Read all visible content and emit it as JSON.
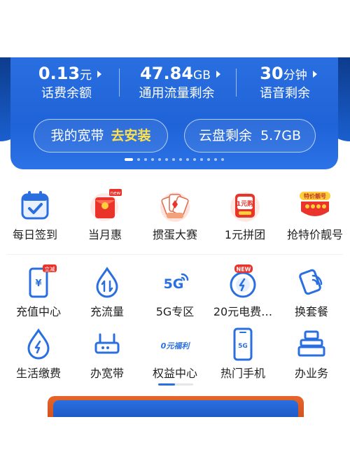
{
  "account": {
    "balance": {
      "value": "0.13",
      "unit": "元",
      "label": "话费余额"
    },
    "data": {
      "value": "47.84",
      "unit": "GB",
      "label": "通用流量剩余"
    },
    "voice": {
      "value": "30",
      "unit": "分钟",
      "label": "语音剩余"
    }
  },
  "pills": {
    "broadband": {
      "label": "我的宽带",
      "action": "去安装"
    },
    "cloud": {
      "label": "云盘剩余",
      "value": "5.7GB"
    }
  },
  "colors": {
    "primary": "#2a6fe0",
    "highlight": "#ffe14a",
    "promo": "#e7652a"
  },
  "promo_row": [
    {
      "label": "每日签到",
      "icon": "calendar-check-icon"
    },
    {
      "label": "当月惠",
      "icon": "red-envelope-icon",
      "badge": "new"
    },
    {
      "label": "掼蛋大赛",
      "icon": "playing-cards-icon"
    },
    {
      "label": "1元拼团",
      "icon": "one-yuan-group-icon",
      "icon_text": "1元购"
    },
    {
      "label": "抢特价靓号",
      "icon": "special-number-icon",
      "icon_text": "特价靓号"
    }
  ],
  "service_row1": [
    {
      "label": "充值中心",
      "icon": "recharge-phone-icon",
      "badge": "立减"
    },
    {
      "label": "充流量",
      "icon": "data-drop-icon"
    },
    {
      "label": "5G专区",
      "icon": "5g-icon",
      "icon_text": "5G"
    },
    {
      "label": "20元电费…",
      "icon": "electricity-bill-icon",
      "badge": "NEW"
    },
    {
      "label": "换套餐",
      "icon": "switch-plan-icon"
    }
  ],
  "service_row2": [
    {
      "label": "生活缴费",
      "icon": "utility-payment-icon"
    },
    {
      "label": "办宽带",
      "icon": "router-icon"
    },
    {
      "label": "权益中心",
      "icon": "benefits-icon",
      "icon_text": "0元福利"
    },
    {
      "label": "热门手机",
      "icon": "phone-5g-icon",
      "icon_text": "5G"
    },
    {
      "label": "办业务",
      "icon": "business-stack-icon"
    }
  ]
}
